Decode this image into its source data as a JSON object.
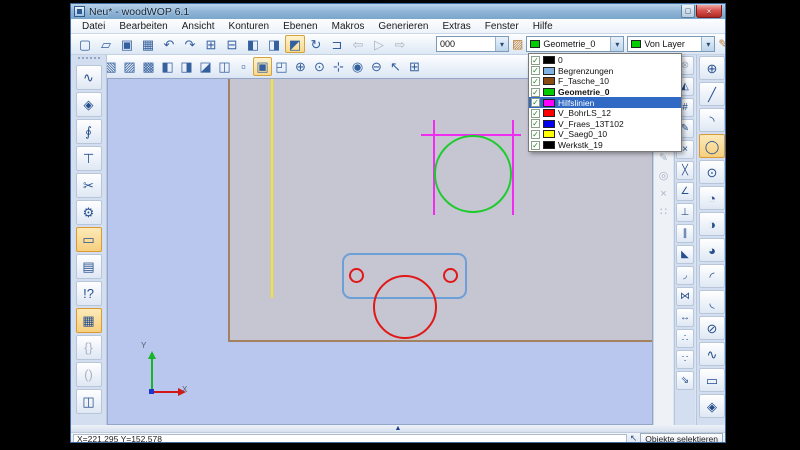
{
  "window": {
    "title": "Neu* - woodWOP 6.1"
  },
  "glyphs": {
    "check": "✓",
    "dropdown_arrow": "▾",
    "close": "×",
    "maximize": "▢",
    "bucket": "▨",
    "pointer": "↖",
    "splitter": "▲",
    "color_tool": "✎"
  },
  "menubar": {
    "items": [
      {
        "name": "menu-datei",
        "label": "Datei"
      },
      {
        "name": "menu-bearbeiten",
        "label": "Bearbeiten"
      },
      {
        "name": "menu-ansicht",
        "label": "Ansicht"
      },
      {
        "name": "menu-konturen",
        "label": "Konturen"
      },
      {
        "name": "menu-ebenen",
        "label": "Ebenen"
      },
      {
        "name": "menu-makros",
        "label": "Makros"
      },
      {
        "name": "menu-generieren",
        "label": "Generieren"
      },
      {
        "name": "menu-extras",
        "label": "Extras"
      },
      {
        "name": "menu-fenster",
        "label": "Fenster"
      },
      {
        "name": "menu-hilfe",
        "label": "Hilfe"
      }
    ]
  },
  "main_toolbar": {
    "buttons": [
      {
        "name": "new-button",
        "glyph": "▢"
      },
      {
        "name": "open-button",
        "glyph": "▱"
      },
      {
        "name": "new-component-button",
        "glyph": "▣"
      },
      {
        "name": "save-button",
        "glyph": "▦"
      },
      {
        "name": "undo-button",
        "glyph": "↶"
      },
      {
        "name": "redo-button",
        "glyph": "↷"
      },
      {
        "name": "new-layer-button",
        "glyph": "⊞"
      },
      {
        "name": "copy-layer-button",
        "glyph": "⊟"
      },
      {
        "name": "view-front-button",
        "glyph": "◧"
      },
      {
        "name": "view-side-button",
        "glyph": "◨"
      },
      {
        "name": "view-3d-button",
        "glyph": "◩",
        "selected": true
      },
      {
        "name": "refresh-view-button",
        "glyph": "↻"
      },
      {
        "name": "postprocessor-button",
        "glyph": "⊐"
      },
      {
        "name": "step-back-button",
        "glyph": "⇦",
        "disabled": true
      },
      {
        "name": "run-button",
        "glyph": "▷",
        "disabled": true
      },
      {
        "name": "step-forward-button",
        "glyph": "⇨",
        "disabled": true
      }
    ],
    "field_value": "000"
  },
  "combos": {
    "layer_value": "Geometrie_0",
    "layer_color": "#00cc00",
    "line_color_value": "Von Layer",
    "line_color": "#00cc00"
  },
  "view_toolbar": {
    "buttons": [
      {
        "name": "view-cube-top-button",
        "glyph": "▧"
      },
      {
        "name": "view-cube-front-button",
        "glyph": "▨"
      },
      {
        "name": "view-cube-left-button",
        "glyph": "▩"
      },
      {
        "name": "view-cube-right-button",
        "glyph": "◧"
      },
      {
        "name": "view-cube-back-button",
        "glyph": "◨"
      },
      {
        "name": "view-cube-bottom-button",
        "glyph": "◪"
      },
      {
        "name": "view-cube-iso-button",
        "glyph": "◫"
      },
      {
        "name": "view-cube-dashed-button",
        "glyph": "▫"
      },
      {
        "name": "fit-view-button",
        "glyph": "▣",
        "selected": true
      },
      {
        "name": "section-view-button",
        "glyph": "◰"
      },
      {
        "name": "zoom-in-button",
        "glyph": "⊕"
      },
      {
        "name": "zoom-window-button",
        "glyph": "⊙"
      },
      {
        "name": "pan-view-button",
        "glyph": "⊹"
      },
      {
        "name": "zoom-dynamic-button",
        "glyph": "◉"
      },
      {
        "name": "zoom-previous-button",
        "glyph": "⊖"
      },
      {
        "name": "select-cursor-button",
        "glyph": "↖"
      },
      {
        "name": "snap-grid-button",
        "glyph": "⊞"
      }
    ]
  },
  "left_toolbar": {
    "buttons": [
      {
        "name": "contour-macro-button",
        "glyph": "∿"
      },
      {
        "name": "surface-macro-button",
        "glyph": "◈"
      },
      {
        "name": "drill-macro-button",
        "glyph": "∮"
      },
      {
        "name": "vertical-drill-macro-button",
        "glyph": "⊤"
      },
      {
        "name": "saw-macro-button",
        "glyph": "✂"
      },
      {
        "name": "circular-saw-macro-button",
        "glyph": "⚙"
      },
      {
        "name": "rectangle-pocket-macro-button",
        "glyph": "▭",
        "selected": true
      },
      {
        "name": "report-button",
        "glyph": "▤"
      },
      {
        "name": "comment-button",
        "glyph": "!?"
      },
      {
        "name": "components-button",
        "glyph": "▦",
        "selected": true
      },
      {
        "name": "group-braces-button",
        "glyph": "{}",
        "disabled": true
      },
      {
        "name": "group-parens-button",
        "glyph": "()",
        "disabled": true
      },
      {
        "name": "block-button",
        "glyph": "◫"
      }
    ]
  },
  "gray_strip": {
    "buttons": [
      {
        "name": "draw-pencil-button",
        "glyph": "✎",
        "disabled": true
      },
      {
        "name": "ring-button",
        "glyph": "◎",
        "disabled": true
      },
      {
        "name": "cross-button",
        "glyph": "×",
        "disabled": true
      },
      {
        "name": "dot-grid-button",
        "glyph": "∷",
        "disabled": true
      }
    ]
  },
  "inner_right_toolbar": {
    "buttons": [
      {
        "name": "close-contour-button",
        "glyph": "⊗",
        "disabled": true
      },
      {
        "name": "dimension-triangle-button",
        "glyph": "◭"
      },
      {
        "name": "dimension-count-button",
        "glyph": "#"
      },
      {
        "name": "dimension-edit-button",
        "glyph": "✎"
      },
      {
        "name": "delete-element-button",
        "glyph": "×"
      },
      {
        "name": "trim-element-button",
        "glyph": "╳"
      },
      {
        "name": "angle-dimension-button",
        "glyph": "∠"
      },
      {
        "name": "perpendicular-button",
        "glyph": "⊥"
      },
      {
        "name": "parallel-button",
        "glyph": "∥"
      },
      {
        "name": "chamfer-button",
        "glyph": "◣"
      },
      {
        "name": "fillet-button",
        "glyph": "◞"
      },
      {
        "name": "mirror-button",
        "glyph": "⋈"
      },
      {
        "name": "stretch-button",
        "glyph": "↔"
      },
      {
        "name": "polyline-node-button",
        "glyph": "∴"
      },
      {
        "name": "curve-node-button",
        "glyph": "∵"
      },
      {
        "name": "export-contour-button",
        "glyph": "⇘"
      }
    ]
  },
  "outer_right_toolbar": {
    "buttons": [
      {
        "name": "point-macro-button",
        "glyph": "⊕"
      },
      {
        "name": "line-macro-button",
        "glyph": "╱"
      },
      {
        "name": "arc-macro-button",
        "glyph": "◝"
      },
      {
        "name": "circle-macro-button",
        "glyph": "◯",
        "selected": true
      },
      {
        "name": "circle-center-radius-button",
        "glyph": "⊙"
      },
      {
        "name": "circle-2point-button",
        "glyph": "◔"
      },
      {
        "name": "circle-3point-button",
        "glyph": "◑"
      },
      {
        "name": "circle-tangent-button",
        "glyph": "◕"
      },
      {
        "name": "arc-center-button",
        "glyph": "◜"
      },
      {
        "name": "arc-tangent-button",
        "glyph": "◟"
      },
      {
        "name": "ellipse-macro-button",
        "glyph": "⊘"
      },
      {
        "name": "spline-macro-button",
        "glyph": "∿"
      },
      {
        "name": "rectangle-macro-button",
        "glyph": "▭"
      },
      {
        "name": "pocket-macro-button",
        "glyph": "◈"
      }
    ]
  },
  "layer_dropdown": {
    "items": [
      {
        "name": "layer-row-0",
        "label": "0",
        "color": "#000000",
        "checked": true
      },
      {
        "name": "layer-row-begrenzungen",
        "label": "Begrenzungen",
        "color": "#7fb2e5",
        "checked": true
      },
      {
        "name": "layer-row-f-tasche",
        "label": "F_Tasche_10",
        "color": "#8b4a12",
        "checked": true
      },
      {
        "name": "layer-row-geometrie",
        "label": "Geometrie_0",
        "color": "#00cc00",
        "checked": true,
        "bold": true
      },
      {
        "name": "layer-row-hilfslinien",
        "label": "Hilfslinien",
        "color": "#ff00ff",
        "checked": true,
        "selected": true
      },
      {
        "name": "layer-row-v-bohrls",
        "label": "V_BohrLS_12",
        "color": "#ff0000",
        "checked": true
      },
      {
        "name": "layer-row-v-fraes",
        "label": "V_Fraes_13T102",
        "color": "#0000ee",
        "checked": true
      },
      {
        "name": "layer-row-v-saeg",
        "label": "V_Saeg0_10",
        "color": "#ffff00",
        "checked": true
      },
      {
        "name": "layer-row-werkstk",
        "label": "Werkstk_19",
        "color": "#000000",
        "checked": true
      }
    ]
  },
  "canvas": {
    "axis_x": "X",
    "axis_y": "Y"
  },
  "colors": {
    "geometry_green": "#1ecb2e",
    "guide_magenta": "#f02cf0",
    "drill_red": "#e01818",
    "boundary_blue": "#6a9fd8",
    "saw_yellow": "#f5e428",
    "axis_green": "#18b428",
    "axis_red": "#d01818"
  },
  "statusbar": {
    "coordinates": "X=221.295 Y=152.578",
    "mode_button": "Objekte selektieren"
  }
}
